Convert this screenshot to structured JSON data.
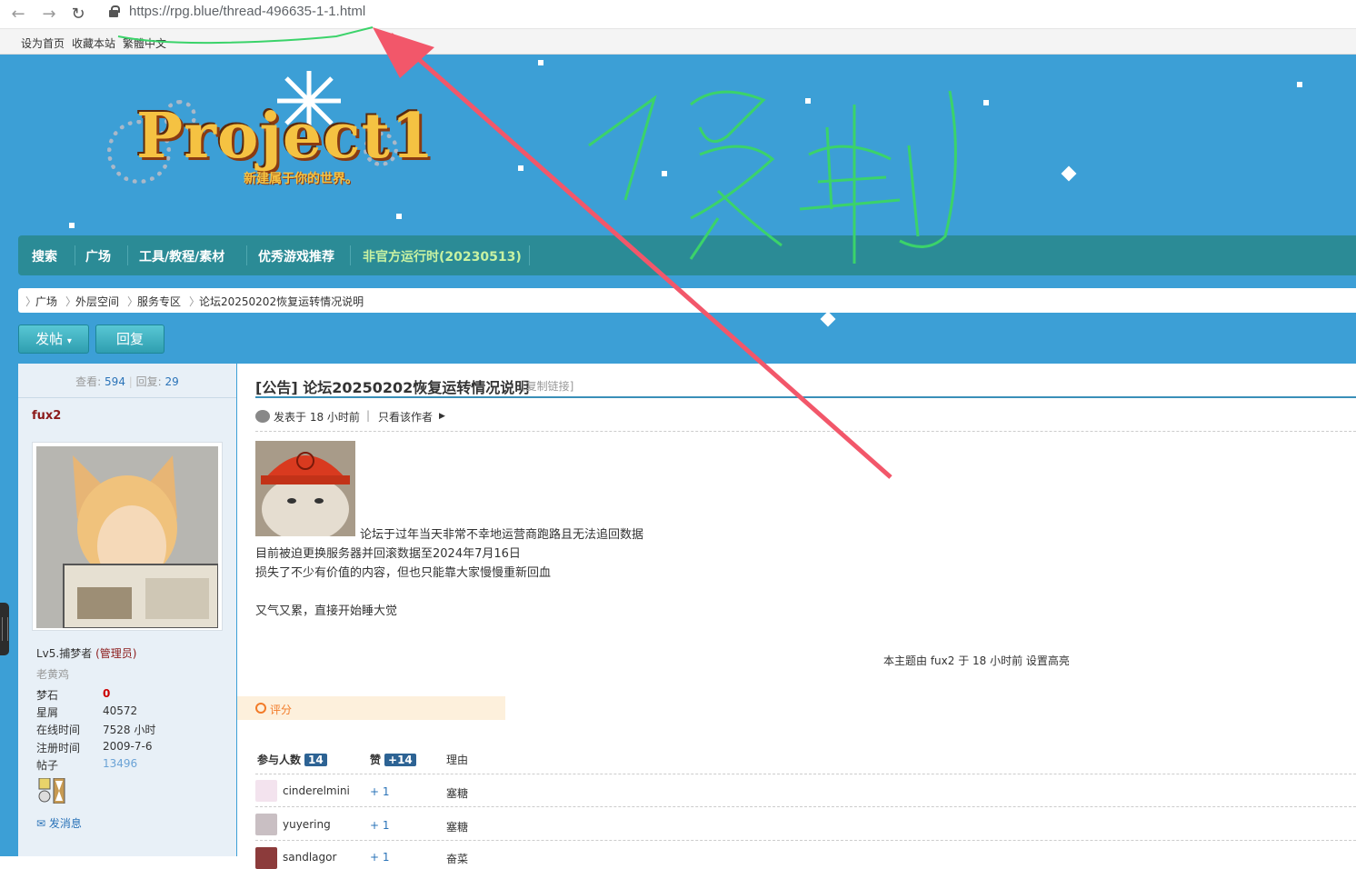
{
  "browser": {
    "url": "https://rpg.blue/thread-496635-1-1.html",
    "back_icon": "arrow-left-icon",
    "forward_icon": "arrow-right-icon",
    "reload_icon": "reload-icon"
  },
  "topbar": {
    "links": [
      "设为首页",
      "收藏本站",
      "繁體中文"
    ]
  },
  "logo": {
    "text": "Project1",
    "subtitle": "新建属于你的世界。"
  },
  "nav": {
    "items": [
      "搜索",
      "广场",
      "工具/教程/素材",
      "优秀游戏推荐",
      "非官方运行时(20230513)"
    ]
  },
  "breadcrumb": {
    "items": [
      "广场",
      "外层空间",
      "服务专区",
      "论坛20250202恢复运转情况说明"
    ]
  },
  "actions": {
    "post": "发帖",
    "reply": "回复"
  },
  "stats": {
    "views_label": "查看:",
    "views": "594",
    "replies_label": "回复:",
    "replies": "29"
  },
  "author": {
    "name": "fux2",
    "level": "Lv5.捕梦者",
    "role": "(管理员)",
    "title": "老黄鸡",
    "fields": [
      {
        "label": "梦石",
        "value": "0"
      },
      {
        "label": "星屑",
        "value": "40572"
      },
      {
        "label": "在线时间",
        "value": "7528 小时"
      },
      {
        "label": "注册时间",
        "value": "2009-7-6"
      },
      {
        "label": "帖子",
        "value": "13496"
      }
    ],
    "send_message": "发消息"
  },
  "post": {
    "title": "[公告] 论坛20250202恢复运转情况说明",
    "copy_link": "[复制链接]",
    "posted": "发表于 18 小时前",
    "only_author": "只看该作者",
    "lines": [
      "论坛于过年当天非常不幸地运营商跑路且无法追回数据",
      "目前被迫更换服务器并回滚数据至2024年7月16日",
      "损失了不少有价值的内容，但也只能靠大家慢慢重新回血",
      "又气又累，直接开始睡大觉"
    ],
    "highlight_note": "本主题由 fux2 于 18 小时前 设置高亮"
  },
  "rating": {
    "title": "评分",
    "participants_label": "参与人数",
    "participants": "14",
    "likes_label": "赞",
    "likes": "+14",
    "reason_label": "理由",
    "rows": [
      {
        "user": "cinderelmini",
        "score": "+ 1",
        "reason": "塞糖"
      },
      {
        "user": "yuyering",
        "score": "+ 1",
        "reason": "塞糖"
      },
      {
        "user": "sandlagor",
        "score": "+ 1",
        "reason": "奋菜"
      }
    ]
  },
  "annotation": {
    "text": "1复制",
    "color": "#3bd36a",
    "arrow_color": "#f2576a"
  }
}
